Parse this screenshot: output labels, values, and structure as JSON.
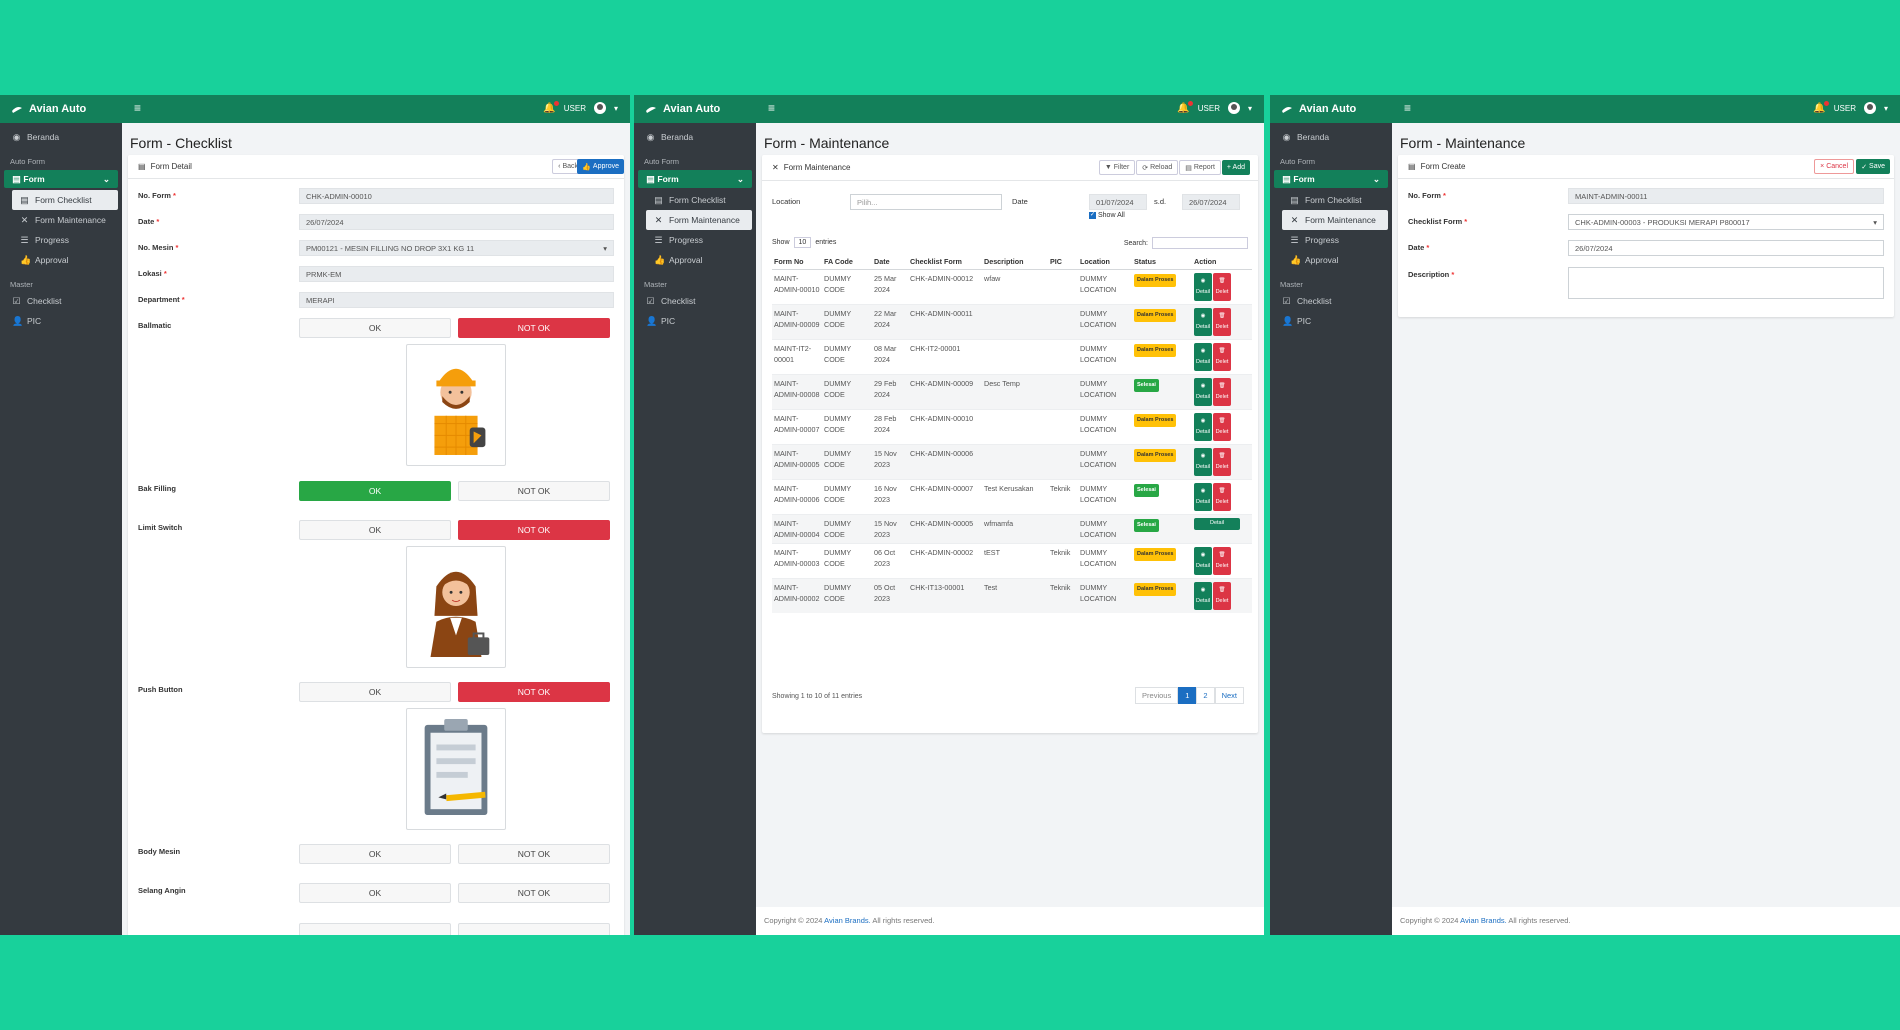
{
  "app": {
    "brand": "Avian Auto",
    "user": "USER",
    "hamburger": "≡"
  },
  "sidebar": {
    "home": "Beranda",
    "section_auto_form": "Auto Form",
    "form": "Form",
    "sub_checklist": "Form Checklist",
    "sub_maintenance": "Form Maintenance",
    "progress": "Progress",
    "approval": "Approval",
    "section_master": "Master",
    "checklist": "Checklist",
    "pic": "PIC"
  },
  "checklist_page": {
    "title": "Form - Checklist",
    "card_title": "Form Detail",
    "back": "Back",
    "approve": "Approve",
    "fields": [
      {
        "label": "No. Form",
        "value": "CHK-ADMIN-00010"
      },
      {
        "label": "Date",
        "value": "26/07/2024"
      },
      {
        "label": "No. Mesin",
        "value": "PM00121 - MESIN FILLING NO DROP 3X1 KG 11"
      },
      {
        "label": "Lokasi",
        "value": "PRMK-EM"
      },
      {
        "label": "Department",
        "value": "MERAPI"
      }
    ],
    "items": [
      {
        "label": "Ballmatic",
        "selected": "NOT OK"
      },
      {
        "label": "Bak Filling",
        "selected": "OK"
      },
      {
        "label": "Limit Switch",
        "selected": "NOT OK"
      },
      {
        "label": "Push Button",
        "selected": "NOT OK"
      },
      {
        "label": "Body Mesin",
        "selected": ""
      },
      {
        "label": "Selang Angin",
        "selected": ""
      }
    ],
    "ok": "OK",
    "not_ok": "NOT OK"
  },
  "maintenance_page": {
    "title": "Form - Maintenance",
    "card_title": "Form Maintenance",
    "filter": "Filter",
    "reload": "Reload",
    "report": "Report",
    "add": "+ Add",
    "location_label": "Location",
    "location_placeholder": "Pilih...",
    "date_label": "Date",
    "date_from": "01/07/2024",
    "sd": "s.d.",
    "date_to": "26/07/2024",
    "show_all": "Show All",
    "show": "Show",
    "entries_value": "10",
    "entries": "entries",
    "search": "Search:",
    "columns": [
      "Form No",
      "FA Code",
      "Date",
      "Checklist Form",
      "Description",
      "PIC",
      "Location",
      "Status",
      "Action"
    ],
    "rows": [
      {
        "no": "MAINT-ADMIN-00010",
        "fa": "DUMMY CODE",
        "date": "25 Mar 2024",
        "cf": "CHK-ADMIN-00012",
        "desc": "wfaw",
        "pic": "",
        "loc": "DUMMY LOCATION",
        "status": "Dalam Proses",
        "action": "detail-delete"
      },
      {
        "no": "MAINT-ADMIN-00009",
        "fa": "DUMMY CODE",
        "date": "22 Mar 2024",
        "cf": "CHK-ADMIN-00011",
        "desc": "",
        "pic": "",
        "loc": "DUMMY LOCATION",
        "status": "Dalam Proses",
        "action": "detail-delete"
      },
      {
        "no": "MAINT-IT2-00001",
        "fa": "DUMMY CODE",
        "date": "08 Mar 2024",
        "cf": "CHK-IT2-00001",
        "desc": "",
        "pic": "",
        "loc": "DUMMY LOCATION",
        "status": "Dalam Proses",
        "action": "detail-delete"
      },
      {
        "no": "MAINT-ADMIN-00008",
        "fa": "DUMMY CODE",
        "date": "29 Feb 2024",
        "cf": "CHK-ADMIN-00009",
        "desc": "Desc Temp",
        "pic": "",
        "loc": "DUMMY LOCATION",
        "status": "Selesai",
        "action": "detail-delete"
      },
      {
        "no": "MAINT-ADMIN-00007",
        "fa": "DUMMY CODE",
        "date": "28 Feb 2024",
        "cf": "CHK-ADMIN-00010",
        "desc": "",
        "pic": "",
        "loc": "DUMMY LOCATION",
        "status": "Dalam Proses",
        "action": "detail-delete"
      },
      {
        "no": "MAINT-ADMIN-00005",
        "fa": "DUMMY CODE",
        "date": "15 Nov 2023",
        "cf": "CHK-ADMIN-00006",
        "desc": "",
        "pic": "",
        "loc": "DUMMY LOCATION",
        "status": "Dalam Proses",
        "action": "detail-delete"
      },
      {
        "no": "MAINT-ADMIN-00006",
        "fa": "DUMMY CODE",
        "date": "16 Nov 2023",
        "cf": "CHK-ADMIN-00007",
        "desc": "Test Kerusakan",
        "pic": "Teknik",
        "loc": "DUMMY LOCATION",
        "status": "Selesai",
        "action": "detail-delete"
      },
      {
        "no": "MAINT-ADMIN-00004",
        "fa": "DUMMY CODE",
        "date": "15 Nov 2023",
        "cf": "CHK-ADMIN-00005",
        "desc": "wfmamfa",
        "pic": "",
        "loc": "DUMMY LOCATION",
        "status": "Selesai",
        "action": "detail"
      },
      {
        "no": "MAINT-ADMIN-00003",
        "fa": "DUMMY CODE",
        "date": "06 Oct 2023",
        "cf": "CHK-ADMIN-00002",
        "desc": "tEST",
        "pic": "Teknik",
        "loc": "DUMMY LOCATION",
        "status": "Dalam Proses",
        "action": "detail-delete"
      },
      {
        "no": "MAINT-ADMIN-00002",
        "fa": "DUMMY CODE",
        "date": "05 Oct 2023",
        "cf": "CHK-IT13-00001",
        "desc": "Test",
        "pic": "Teknik",
        "loc": "DUMMY LOCATION",
        "status": "Dalam Proses",
        "action": "detail-delete"
      }
    ],
    "detail": "Detail",
    "delete": "Delet",
    "showing": "Showing 1 to 10 of 11 entries",
    "previous": "Previous",
    "page1": "1",
    "page2": "2",
    "next": "Next"
  },
  "create_page": {
    "title": "Form - Maintenance",
    "card_title": "Form Create",
    "cancel": "Cancel",
    "save": "Save",
    "no_form_label": "No. Form",
    "no_form": "MAINT-ADMIN-00011",
    "checklist_label": "Checklist Form",
    "checklist_value": "CHK-ADMIN-00003 - PRODUKSI MERAPI P800017",
    "date_label": "Date",
    "date_value": "26/07/2024",
    "desc_label": "Description"
  },
  "footer": {
    "prefix": "Copyright © 2024",
    "brand": "Avian Brands.",
    "suffix": "All rights reserved."
  },
  "colors": {
    "background": "#18d19b",
    "primary": "#13805a",
    "danger": "#dc3545",
    "success": "#28a745",
    "warning": "#ffc107",
    "sidebar": "#343a40"
  }
}
